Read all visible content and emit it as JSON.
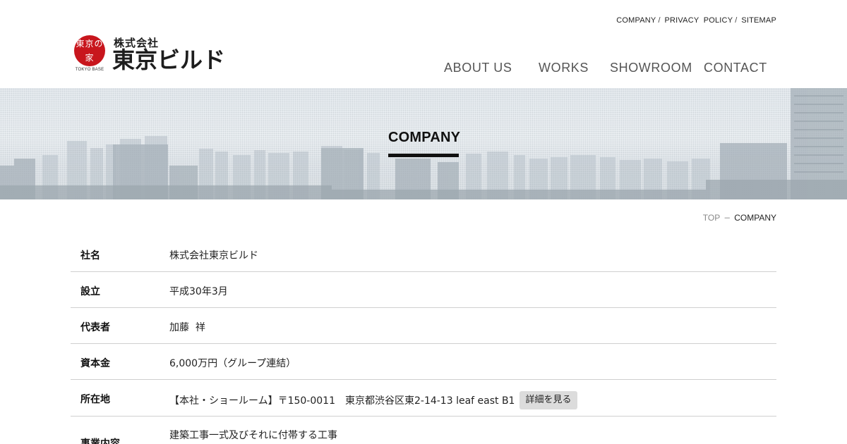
{
  "utility_nav": {
    "company": "COMPANY",
    "privacy_policy": "PRIVACY  POLICY",
    "sitemap": "SITEMAP",
    "separator": "/"
  },
  "logo": {
    "seal_text": "東京の家",
    "seal_sub": "TOKYO BASE",
    "company_prefix": "株式会社",
    "company_name": "東京ビルド",
    "brand_color": "#c8161d"
  },
  "main_nav": {
    "about": "ABOUT US",
    "works": "WORKS",
    "showroom": "SHOWROOM",
    "contact": "CONTACT"
  },
  "hero": {
    "title": "COMPANY"
  },
  "breadcrumb": {
    "top": "TOP",
    "separator": "－",
    "current": "COMPANY"
  },
  "company_info": {
    "rows": [
      {
        "label": "社名",
        "value": "株式会社東京ビルド"
      },
      {
        "label": "設立",
        "value": "平成30年3月"
      },
      {
        "label": "代表者",
        "value": "加藤  祥"
      },
      {
        "label": "資本金",
        "value": "6,000万円（グループ連結）"
      },
      {
        "label": "所在地",
        "value": "【本社・ショールーム】〒150-0011　東京都渋谷区東2-14-13 leaf east B1",
        "button": "詳細を見る"
      },
      {
        "label": "事業内容",
        "value": "建築工事一式及びそれに付帯する工事"
      }
    ]
  }
}
